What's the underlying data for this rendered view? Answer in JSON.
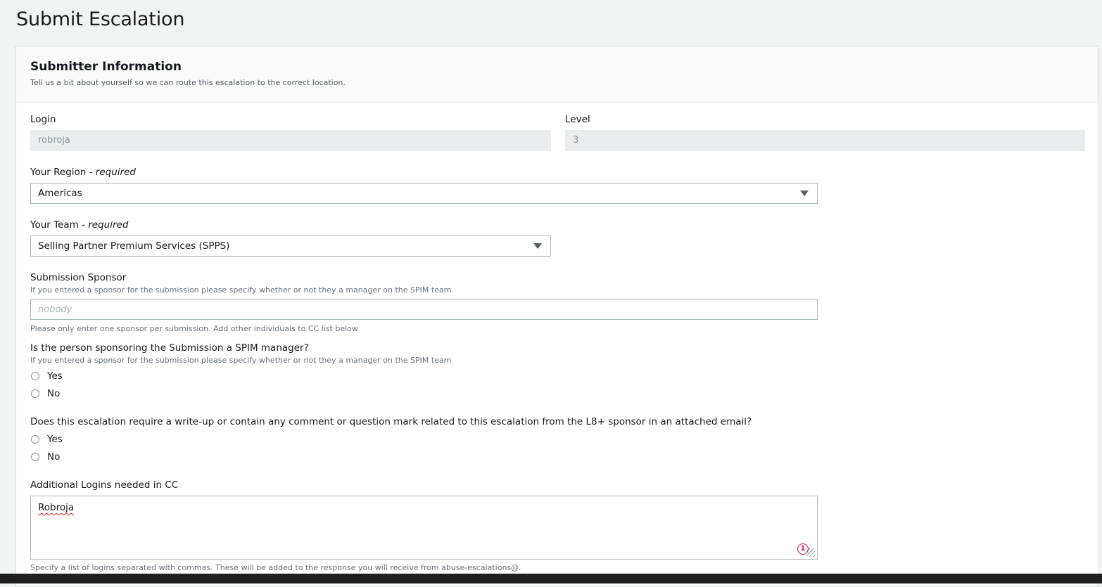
{
  "page": {
    "title": "Submit Escalation"
  },
  "section": {
    "title": "Submitter Information",
    "description": "Tell us a bit about yourself so we can route this escalation to the correct location."
  },
  "login": {
    "label": "Login",
    "value": "robroja"
  },
  "level": {
    "label": "Level",
    "value": "3"
  },
  "region": {
    "label": "Your Region",
    "required": "- required",
    "selected": "Americas"
  },
  "team": {
    "label": "Your Team",
    "required": "- required",
    "selected": "Selling Partner Premium Services (SPPS)"
  },
  "sponsor": {
    "label": "Submission Sponsor",
    "hint": "If you entered a sponsor for the submission please specify whether or not they a manager on the SPIM team",
    "placeholder": "nobody",
    "footer": "Please only enter one sponsor per submission. Add other individuals to CC list below"
  },
  "spim_manager": {
    "question": "Is the person sponsoring the Submission a SPIM manager?",
    "hint": "If you entered a sponsor for the submission please specify whether or not they a manager on the SPIM team",
    "yes": "Yes",
    "no": "No"
  },
  "writeup": {
    "question": "Does this escalation require a write-up or contain any comment or question mark related to this escalation from the L8+ sponsor in an attached email?",
    "yes": "Yes",
    "no": "No"
  },
  "cc": {
    "label": "Additional Logins needed in CC",
    "value": "Robroja",
    "badge": "1",
    "footer": "Specify a list of logins separated with commas. These will be added to the response you will receive from abuse-escalations@."
  },
  "colors": {
    "background": "#f2f3f3",
    "border": "#aab7b8",
    "disabled": "#eaeded",
    "badge": "#d4145a"
  }
}
